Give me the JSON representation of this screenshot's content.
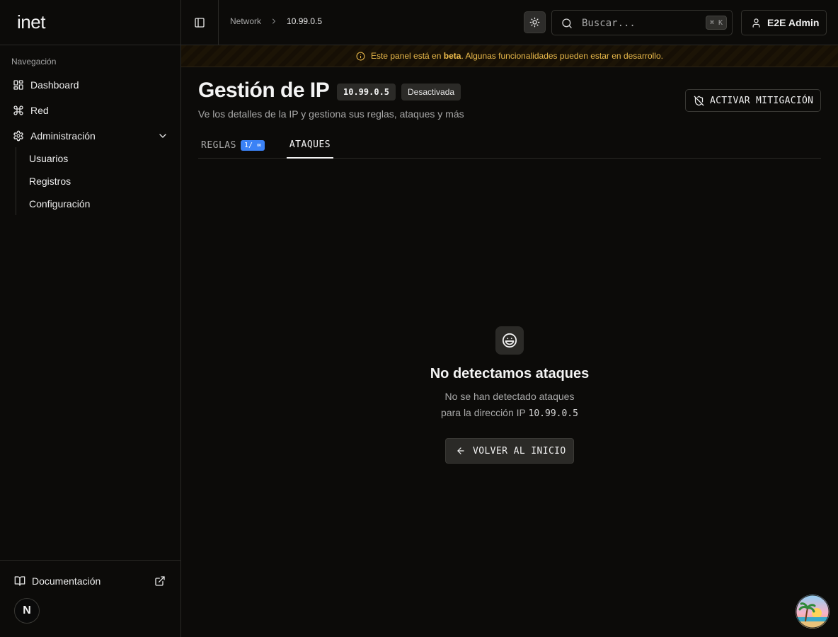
{
  "brand": {
    "logo": "inet"
  },
  "sidebar": {
    "section_label": "Navegación",
    "items": [
      {
        "label": "Dashboard",
        "icon": "dashboard-icon"
      },
      {
        "label": "Red",
        "icon": "command-icon"
      },
      {
        "label": "Administración",
        "icon": "gear-icon",
        "expanded": true
      }
    ],
    "admin_children": [
      {
        "label": "Usuarios"
      },
      {
        "label": "Registros"
      },
      {
        "label": "Configuración"
      }
    ],
    "footer": {
      "docs_label": "Documentación",
      "avatar_letter": "N"
    }
  },
  "header": {
    "breadcrumb": [
      "Network",
      "10.99.0.5"
    ],
    "search": {
      "placeholder": "Buscar...",
      "shortcut": "⌘ K"
    },
    "user_label": "E2E Admin"
  },
  "banner": {
    "prefix": "Este panel está en ",
    "highlight": "beta",
    "suffix": ". Algunas funcionalidades pueden estar en desarrollo."
  },
  "page": {
    "title": "Gestión de IP",
    "ip": "10.99.0.5",
    "status": "Desactivada",
    "subtitle": "Ve los detalles de la IP y gestiona sus reglas, ataques y más",
    "mitigate_label": "ACTIVAR MITIGACIÓN"
  },
  "tabs": [
    {
      "label": "REGLAS",
      "badge": "1/ ∞",
      "active": false
    },
    {
      "label": "ATAQUES",
      "active": true
    }
  ],
  "empty_state": {
    "title": "No detectamos ataques",
    "line1": "No se han detectado ataques",
    "line2_prefix": "para la dirección IP ",
    "ip": "10.99.0.5",
    "button_label": "VOLVER AL INICIO"
  },
  "colors": {
    "background": "#0c0b09",
    "accent_blue": "#3b82f6",
    "banner_text": "#e8b84a"
  }
}
